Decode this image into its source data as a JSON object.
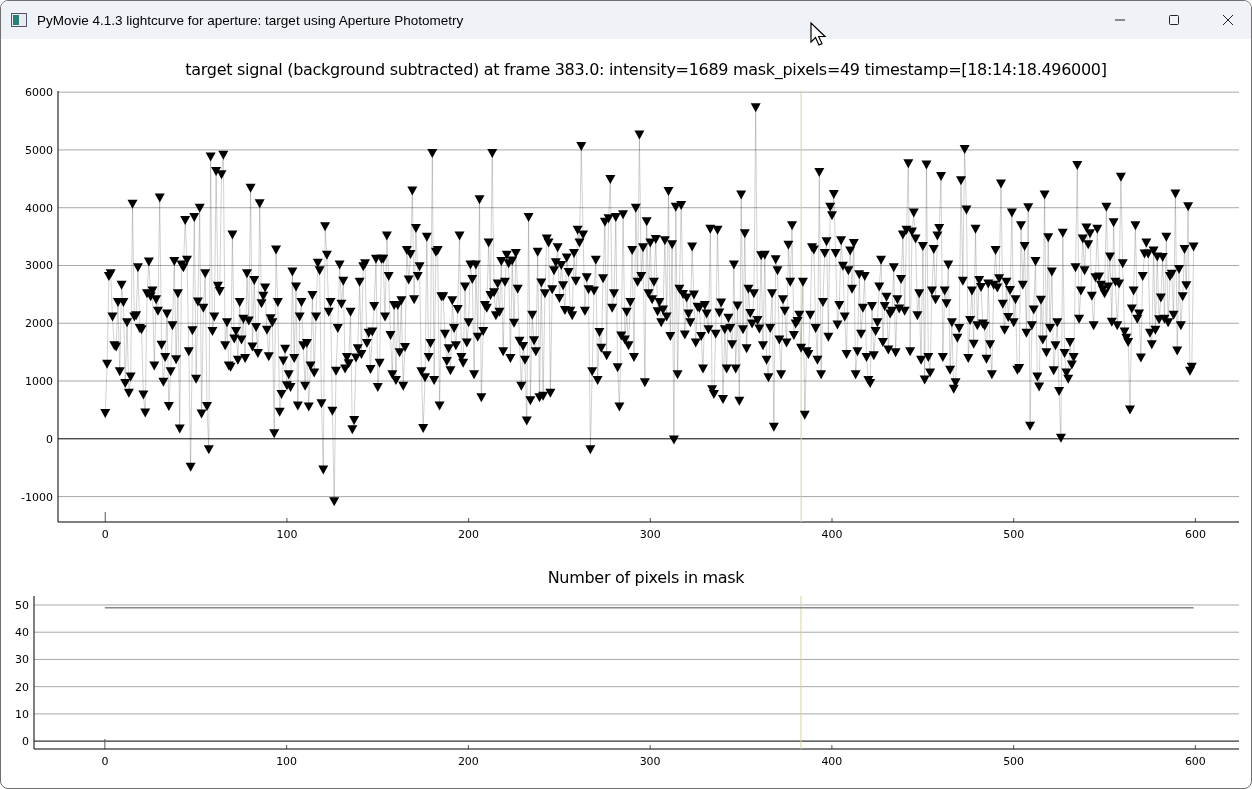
{
  "window": {
    "title": "PyMovie 4.1.3 lightcurve for aperture: target using Aperture Photometry"
  },
  "charts": [
    {
      "title": "target signal (background subtracted) at frame 383.0: intensity=1689 mask_pixels=49 timestamp=[18:14:18.496000]",
      "chart_data": {
        "type": "line",
        "grid": true,
        "xlim": [
          -26,
          624
        ],
        "ylim": [
          -1440,
          6020
        ],
        "xticks": [
          0,
          100,
          200,
          300,
          400,
          500,
          600
        ],
        "yticks": [
          -1000,
          0,
          1000,
          2000,
          3000,
          4000,
          5000,
          6000
        ],
        "ref_lines": [
          {
            "axis": "x",
            "value": 383
          }
        ],
        "x": [
          0,
          1,
          2,
          3,
          4,
          5,
          6,
          7,
          8,
          9,
          10,
          11,
          12,
          13,
          14,
          15,
          16,
          17,
          18,
          19,
          20,
          21,
          22,
          23,
          24,
          25,
          26,
          27,
          28,
          29,
          30,
          31,
          32,
          33,
          34,
          35,
          36,
          37,
          38,
          39,
          40,
          41,
          42,
          43,
          44,
          45,
          46,
          47,
          48,
          49,
          50,
          51,
          52,
          53,
          54,
          55,
          56,
          57,
          58,
          59,
          60,
          61,
          62,
          63,
          64,
          65,
          66,
          67,
          68,
          69,
          70,
          71,
          72,
          73,
          74,
          75,
          76,
          77,
          78,
          79,
          80,
          81,
          82,
          83,
          84,
          85,
          86,
          87,
          88,
          89,
          90,
          91,
          92,
          93,
          94,
          95,
          96,
          97,
          98,
          99,
          100,
          101,
          102,
          103,
          104,
          105,
          106,
          107,
          108,
          109,
          110,
          111,
          112,
          113,
          114,
          115,
          116,
          117,
          118,
          119,
          120,
          121,
          122,
          123,
          124,
          125,
          126,
          127,
          128,
          129,
          130,
          131,
          132,
          133,
          134,
          135,
          136,
          137,
          138,
          139,
          140,
          141,
          142,
          143,
          144,
          145,
          146,
          147,
          148,
          149,
          150,
          151,
          152,
          153,
          154,
          155,
          156,
          157,
          158,
          159,
          160,
          161,
          162,
          163,
          164,
          165,
          166,
          167,
          168,
          169,
          170,
          171,
          172,
          173,
          174,
          175,
          176,
          177,
          178,
          179,
          180,
          181,
          182,
          183,
          184,
          185,
          186,
          187,
          188,
          189,
          190,
          191,
          192,
          193,
          194,
          195,
          196,
          197,
          198,
          199,
          200,
          201,
          202,
          203,
          204,
          205,
          206,
          207,
          208,
          209,
          210,
          211,
          212,
          213,
          214,
          215,
          216,
          217,
          218,
          219,
          220,
          221,
          222,
          223,
          224,
          225,
          226,
          227,
          228,
          229,
          230,
          231,
          232,
          233,
          234,
          235,
          236,
          237,
          238,
          239,
          240,
          241,
          242,
          243,
          244,
          245,
          246,
          247,
          248,
          249,
          250,
          251,
          252,
          253,
          254,
          255,
          256,
          257,
          258,
          259,
          260,
          261,
          262,
          263,
          264,
          265,
          266,
          267,
          268,
          269,
          270,
          271,
          272,
          273,
          274,
          275,
          276,
          277,
          278,
          279,
          280,
          281,
          282,
          283,
          284,
          285,
          286,
          287,
          288,
          289,
          290,
          291,
          292,
          293,
          294,
          295,
          296,
          297,
          298,
          299,
          300,
          301,
          302,
          303,
          304,
          305,
          306,
          307,
          308,
          309,
          310,
          311,
          312,
          313,
          314,
          315,
          316,
          317,
          318,
          319,
          320,
          321,
          322,
          323,
          324,
          325,
          326,
          327,
          328,
          329,
          330,
          331,
          332,
          333,
          334,
          335,
          336,
          337,
          338,
          339,
          340,
          341,
          342,
          343,
          344,
          345,
          346,
          347,
          348,
          349,
          350,
          351,
          352,
          353,
          354,
          355,
          356,
          357,
          358,
          359,
          360,
          361,
          362,
          363,
          364,
          365,
          366,
          367,
          368,
          369,
          370,
          371,
          372,
          373,
          374,
          375,
          376,
          377,
          378,
          379,
          380,
          381,
          382,
          383,
          384,
          385,
          386,
          387,
          388,
          389,
          390,
          391,
          392,
          393,
          394,
          395,
          396,
          397,
          398,
          399,
          400,
          401,
          402,
          403,
          404,
          405,
          406,
          407,
          408,
          409,
          410,
          411,
          412,
          413,
          414,
          415,
          416,
          417,
          418,
          419,
          420,
          421,
          422,
          423,
          424,
          425,
          426,
          427,
          428,
          429,
          430,
          431,
          432,
          433,
          434,
          435,
          436,
          437,
          438,
          439,
          440,
          441,
          442,
          443,
          444,
          445,
          446,
          447,
          448,
          449,
          450,
          451,
          452,
          453,
          454,
          455,
          456,
          457,
          458,
          459,
          460,
          461,
          462,
          463,
          464,
          465,
          466,
          467,
          468,
          469,
          470,
          471,
          472,
          473,
          474,
          475,
          476,
          477,
          478,
          479,
          480,
          481,
          482,
          483,
          484,
          485,
          486,
          487,
          488,
          489,
          490,
          491,
          492,
          493,
          494,
          495,
          496,
          497,
          498,
          499,
          500,
          501,
          502,
          503,
          504,
          505,
          506,
          507,
          508,
          509,
          510,
          511,
          512,
          513,
          514,
          515,
          516,
          517,
          518,
          519,
          520,
          521,
          522,
          523,
          524,
          525,
          526,
          527,
          528,
          529,
          530,
          531,
          532,
          533,
          534,
          535,
          536,
          537,
          538,
          539,
          540,
          541,
          542,
          543,
          544,
          545,
          546,
          547,
          548,
          549,
          550,
          551,
          552,
          553,
          554,
          555,
          556,
          557,
          558,
          559,
          560,
          561,
          562,
          563,
          564,
          565,
          566,
          567,
          568,
          569,
          570,
          571,
          572,
          573,
          574,
          575,
          576,
          577,
          578,
          579,
          580,
          581,
          582,
          583,
          584,
          585,
          586,
          587,
          588,
          589,
          590,
          591,
          592,
          593,
          594,
          595,
          596,
          597,
          598,
          599
        ],
        "series": [
          {
            "color": "#000000",
            "marker": "triangle_down",
            "values": [
              430,
              1280,
              2800,
              2850,
              2100,
              1600,
              1580,
              2350,
              1150,
              2650,
              2350,
              950,
              2000,
              780,
              1060,
              4050,
              2100,
              2120,
              2950,
              1900,
              1880,
              750,
              440,
              2500,
              3050,
              2450,
              2550,
              1250,
              2400,
              2200,
              4160,
              1610,
              970,
              1400,
              2150,
              550,
              1150,
              1950,
              3060,
              1360,
              2500,
              160,
              3000,
              2950,
              3770,
              3080,
              1500,
              -500,
              1860,
              3820,
              1020,
              2360,
              3980,
              420,
              2250,
              2850,
              550,
              -200,
              4870,
              1850,
              2100,
              4620,
              2630,
              2540,
              4560,
              4900,
              1600,
              2000,
              1250,
              1230,
              3520,
              1720,
              1850,
              1350,
              2350,
              1700,
              2060,
              1380,
              2850,
              2030,
              4330,
              1580,
              2730,
              1920,
              1470,
              4060,
              2330,
              2460,
              2600,
              1870,
              1410,
              2070,
              2000,
              80,
              3260,
              2350,
              450,
              760,
              1340,
              1540,
              910,
              1100,
              880,
              2880,
              1380,
              2620,
              560,
              2100,
              2350,
              1600,
              900,
              1640,
              540,
              1250,
              2470,
              1130,
              2100,
              3030,
              2900,
              600,
              -550,
              3660,
              3170,
              2180,
              2350,
              470,
              -1100,
              1160,
              1900,
              3000,
              2320,
              2720,
              1200,
              1400,
              1290,
              2180,
              150,
              310,
              1390,
              1550,
              2700,
              1450,
              2970,
              3020,
              1640,
              1820,
              1190,
              1840,
              2280,
              3100,
              880,
              1300,
              3100,
              3100,
              2100,
              3500,
              2800,
              1780,
              1100,
              2300,
              1000,
              2300,
              1480,
              2380,
              900,
              1570,
              3250,
              2740,
              3180,
              4280,
              2400,
              3630,
              2800,
              2970,
              1150,
              170,
              1050,
              3480,
              1400,
              1640,
              4930,
              1000,
              3220,
              3250,
              560,
              2450,
              2450,
              1800,
              1330,
              1550,
              1170,
              2380,
              1900,
              1600,
              2230,
              3500,
              1400,
              1300,
              2620,
              1650,
              2000,
              3000,
              2750,
              1100,
              3000,
              1750,
              4130,
              700,
              1850,
              2300,
              2250,
              3380,
              2470,
              4930,
              2520,
              2120,
              2670,
              2180,
              3060,
              1500,
              2700,
              3170,
              3020,
              1380,
              3070,
              1990,
              3200,
              2580,
              1680,
              900,
              1590,
              1350,
              300,
              3820,
              650,
              2130,
              1690,
              1500,
              3220,
              700,
              2690,
              730,
              2500,
              3450,
              3380,
              780,
              2570,
              2900,
              3040,
              3300,
              2420,
              2990,
              2640,
              2210,
              3120,
              2870,
              2200,
              2120,
              3200,
              2720,
              3600,
              3380,
              5050,
              3520,
              2200,
              2780,
              2570,
              -200,
              1150,
              2550,
              3080,
              1000,
              1830,
              1560,
              2760,
              3740,
              1430,
              3800,
              4480,
              2250,
              2500,
              3820,
              1220,
              540,
              1770,
              3870,
              1700,
              2180,
              1600,
              2350,
              3250,
              1400,
              3980,
              2700,
              5250,
              2800,
              3300,
              960,
              3750,
              2500,
              3380,
              2400,
              2700,
              3440,
              2190,
              2350,
              2000,
              2220,
              3420,
              2100,
              4270,
              1760,
              3350,
              -30,
              4000,
              1100,
              2580,
              4030,
              2490,
              1790,
              2430,
              2150,
              2000,
              3310,
              2480,
              1650,
              2270,
              2250,
              1760,
              1200,
              2300,
              2150,
              1880,
              3620,
              840,
              760,
              1800,
              3600,
              2170,
              2340,
              670,
              1880,
              1200,
              2080,
              1900,
              1620,
              3000,
              1200,
              2290,
              640,
              4210,
              1880,
              3540,
              1550,
              2580,
              2160,
              1980,
              2500,
              5720,
              2040,
              1890,
              3160,
              1600,
              3170,
              1350,
              1050,
              1900,
              2500,
              190,
              3090,
              2900,
              1700,
              1100,
              2400,
              2200,
              1650,
              3340,
              2700,
              3680,
              1780,
              1980,
              2020,
              2130,
              1560,
              2700,
              400,
              1500,
              1450,
              2130,
              3300,
              3260,
              1900,
              1350,
              4600,
              1100,
              2350,
              3200,
              3400,
              1750,
              4000,
              3850,
              4220,
              3200,
              1960,
              2300,
              3420,
              2980,
              2100,
              1450,
              2900,
              3240,
              2580,
              3370,
              1100,
              1500,
              2830,
              1800,
              2250,
              2800,
              1400,
              1000,
              950,
              2280,
              1430,
              1850,
              2000,
              2620,
              3080,
              1660,
              2280,
              2440,
              1530,
              2150,
              2200,
              2950,
              1480,
              2400,
              2240,
              2750,
              3520,
              2200,
              3600,
              4750,
              1500,
              3570,
              3900,
              3450,
              2120,
              2500,
              1350,
              3320,
              1010,
              4730,
              1400,
              1130,
              2550,
              3270,
              2400,
              3500,
              3630,
              4530,
              1400,
              2550,
              2330,
              3000,
              1180,
              2000,
              850,
              960,
              1730,
              1900,
              4460,
              2720,
              5000,
              3950,
              1380,
              2040,
              2550,
              1630,
              3620,
              1950,
              2730,
              2610,
              1980,
              1940,
              1370,
              2670,
              1620,
              1100,
              2650,
              3250,
              2600,
              2760,
              4400,
              2320,
              1870,
              2700,
              2090,
              2560,
              3900,
              2000,
              2400,
              1180,
              1210,
              3680,
              2650,
              3320,
              1820,
              3990,
              210,
              1950,
              2220,
              3060,
              1060,
              890,
              2390,
              1700,
              4210,
              1480,
              3470,
              1900,
              2880,
              1170,
              1600,
              2000,
              810,
              0,
              3550,
              1470,
              1130,
              1020,
              1660,
              1270,
              1400,
              2950,
              4720,
              2060,
              2550,
              3450,
              2900,
              3640,
              3350,
              3540,
              2460,
              1950,
              2780,
              3620,
              2790,
              2650,
              2570,
              2500,
              4000,
              2620,
              3140,
              2010,
              3730,
              2700,
              1950,
              2670,
              4520,
              3020,
              1840,
              1730,
              1660,
              490,
              2240,
              2550,
              3680,
              2060,
              2150,
              1390,
              2800,
              3190,
              3380,
              3190,
              1820,
              1620,
              3240,
              1870,
              3140,
              2050,
              2430,
              3130,
              2060,
              3480,
              2000,
              2800,
              2840,
              2130,
              4230,
              1510,
              2920,
              1950,
              2450,
              3270,
              2640,
              4010,
              1160,
              1230,
              3310
            ]
          }
        ]
      }
    },
    {
      "title": "Number of pixels in mask",
      "chart_data": {
        "type": "line",
        "grid": true,
        "x": [
          0,
          599
        ],
        "xlim": [
          -39,
          624
        ],
        "ylim": [
          -2.9,
          53.3
        ],
        "xticks": [
          0,
          100,
          200,
          300,
          400,
          500,
          600
        ],
        "yticks": [
          0,
          10,
          20,
          30,
          40,
          50
        ],
        "ref_lines": [
          {
            "axis": "x",
            "value": 383
          }
        ],
        "series": [
          {
            "color": "#888888",
            "values": [
              49,
              49
            ]
          }
        ]
      }
    }
  ]
}
